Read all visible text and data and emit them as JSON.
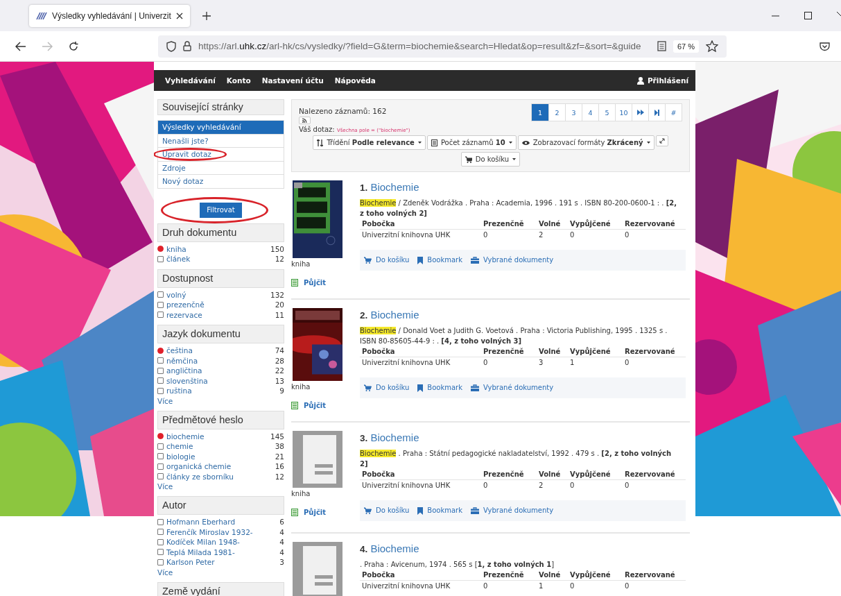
{
  "browser": {
    "tab_title": "Výsledky vyhledávání | Univerzit",
    "nav_buttons": [
      {
        "kind": "back",
        "disabled": false
      },
      {
        "kind": "forward",
        "disabled": true
      },
      {
        "kind": "reload",
        "disabled": false
      }
    ],
    "url": {
      "scheme": "https://arl.",
      "domain": "uhk.cz",
      "path": "/arl-hk/cs/vysledky/?field=G&term=biochemie&search=Hledat&op=result&zf=&sort=&guide"
    },
    "zoom": "67 %"
  },
  "nav": {
    "items": [
      "Vyhledávání",
      "Konto",
      "Nastavení účtu",
      "Nápověda"
    ],
    "login": "Přihlášení"
  },
  "sidebar": {
    "related": {
      "title": "Související stránky",
      "links": [
        {
          "label": "Výsledky vyhledávání",
          "selected": true,
          "circled": false
        },
        {
          "label": "Nenašli jste?",
          "selected": false,
          "circled": false
        },
        {
          "label": "Upravit dotaz",
          "selected": false,
          "circled": true
        },
        {
          "label": "Zdroje",
          "selected": false,
          "circled": false
        },
        {
          "label": "Nový dotaz",
          "selected": false,
          "circled": false
        }
      ]
    },
    "filter_button": {
      "label": "Filtrovat",
      "circled": true
    },
    "facets": [
      {
        "title": "Druh dokumentu",
        "items": [
          {
            "label": "kniha",
            "count": "150",
            "checked": true
          },
          {
            "label": "článek",
            "count": "12",
            "checked": false
          }
        ]
      },
      {
        "title": "Dostupnost",
        "items": [
          {
            "label": "volný",
            "count": "132",
            "checked": false
          },
          {
            "label": "prezenčně",
            "count": "20",
            "checked": false
          },
          {
            "label": "rezervace",
            "count": "11",
            "checked": false
          }
        ]
      },
      {
        "title": "Jazyk dokumentu",
        "items": [
          {
            "label": "čeština",
            "count": "74",
            "checked": true
          },
          {
            "label": "němčina",
            "count": "28",
            "checked": false
          },
          {
            "label": "angličtina",
            "count": "22",
            "checked": false
          },
          {
            "label": "slovenština",
            "count": "13",
            "checked": false
          },
          {
            "label": "ruština",
            "count": "9",
            "checked": false
          }
        ],
        "more": "Více"
      },
      {
        "title": "Předmětové heslo",
        "items": [
          {
            "label": "biochemie",
            "count": "145",
            "checked": true
          },
          {
            "label": "chemie",
            "count": "38",
            "checked": false
          },
          {
            "label": "biologie",
            "count": "21",
            "checked": false
          },
          {
            "label": "organická chemie",
            "count": "16",
            "checked": false
          },
          {
            "label": "články ze sborníku",
            "count": "12",
            "checked": false
          }
        ],
        "more": "Více"
      },
      {
        "title": "Autor",
        "items": [
          {
            "label": "Hofmann Eberhard",
            "count": "6",
            "checked": false
          },
          {
            "label": "Ferenčík Miroslav 1932-",
            "count": "4",
            "checked": false
          },
          {
            "label": "Kodíček Milan 1948-",
            "count": "4",
            "checked": false
          },
          {
            "label": "Teplá Milada 1981-",
            "count": "4",
            "checked": false
          },
          {
            "label": "Karlson Peter",
            "count": "3",
            "checked": false
          }
        ],
        "more": "Více"
      },
      {
        "title": "Země vydání"
      }
    ]
  },
  "main": {
    "found": "Nalezeno záznamů: 162",
    "pagination": [
      {
        "kind": "page",
        "label": "1",
        "selected": true
      },
      {
        "kind": "page",
        "label": "2",
        "selected": false
      },
      {
        "kind": "page",
        "label": "3",
        "selected": false
      },
      {
        "kind": "page",
        "label": "4",
        "selected": false
      },
      {
        "kind": "page",
        "label": "5",
        "selected": false
      },
      {
        "kind": "page",
        "label": "10",
        "selected": false
      },
      {
        "kind": "next",
        "selected": false
      },
      {
        "kind": "last",
        "selected": false
      },
      {
        "kind": "page",
        "label": "#",
        "selected": false
      }
    ],
    "query": {
      "label": "Váš dotaz:",
      "value": "Všechna pole = (\"biochemie\")"
    },
    "controls": [
      {
        "kind": "sort",
        "label": "Třídění",
        "value": "Podle relevance"
      },
      {
        "kind": "count",
        "label": "Počet záznamů",
        "value": "10"
      },
      {
        "kind": "format",
        "label": "Zobrazovací formáty",
        "value": "Zkrácený"
      },
      {
        "kind": "expand"
      },
      {
        "kind": "cart",
        "label": "Do košíku"
      }
    ],
    "results": [
      {
        "number": "1.",
        "title": "Biochemie",
        "cover": {
          "kind": "picture"
        },
        "highlight": "Biochemie",
        "description": " / Zdeněk Vodrážka . Praha : Academia, 1996 . 191 s . ISBN 80-200-0600-1 : .   **[2, z toho volných 2]**",
        "columns": [
          "Pobočka",
          "Prezenčně",
          "Volné",
          "Vypůjčené",
          "Rezervované"
        ],
        "rows": [
          [
            "Univerzitní knihovna UHK",
            "0",
            "2",
            "0",
            "0"
          ]
        ],
        "actions": [
          "Do košíku",
          "Bookmark",
          "Vybrané dokumenty"
        ],
        "doc_type": "kniha",
        "borrow": "Půjčit"
      },
      {
        "number": "2.",
        "title": "Biochemie",
        "cover": {
          "kind": "picture"
        },
        "highlight": "Biochemie",
        "description": " / Donald Voet a Judith G. Voetová . Praha : Victoria Publishing, 1995 . 1325 s . ISBN 80-85605-44-9 : .   **[4, z toho volných 3]**",
        "columns": [
          "Pobočka",
          "Prezenčně",
          "Volné",
          "Vypůjčené",
          "Rezervované"
        ],
        "rows": [
          [
            "Univerzitní knihovna UHK",
            "0",
            "3",
            "1",
            "0"
          ]
        ],
        "actions": [
          "Do košíku",
          "Bookmark",
          "Vybrané dokumenty"
        ],
        "doc_type": "kniha",
        "borrow": "Půjčit"
      },
      {
        "number": "3.",
        "title": "Biochemie",
        "cover": {
          "kind": "placeholder"
        },
        "highlight": "Biochemie",
        "description": " . Praha : Státní pedagogické nakladatelství, 1992 . 479 s .   **[2, z toho volných 2]**",
        "columns": [
          "Pobočka",
          "Prezenčně",
          "Volné",
          "Vypůjčené",
          "Rezervované"
        ],
        "rows": [
          [
            "Univerzitní knihovna UHK",
            "0",
            "2",
            "0",
            "0"
          ]
        ],
        "actions": [
          "Do košíku",
          "Bookmark",
          "Vybrané dokumenty"
        ],
        "doc_type": "kniha",
        "borrow": "Půjčit"
      },
      {
        "number": "4.",
        "title": "Biochemie",
        "cover": {
          "kind": "placeholder"
        },
        "description": ". Praha : Avicenum, 1974 . 565 s [**1, z toho volných 1**]",
        "columns": [
          "Pobočka",
          "Prezenčně",
          "Volné",
          "Vypůjčené",
          "Rezervované"
        ],
        "rows": [
          [
            "Univerzitní knihovna UHK",
            "0",
            "1",
            "0",
            "0"
          ]
        ]
      }
    ]
  }
}
